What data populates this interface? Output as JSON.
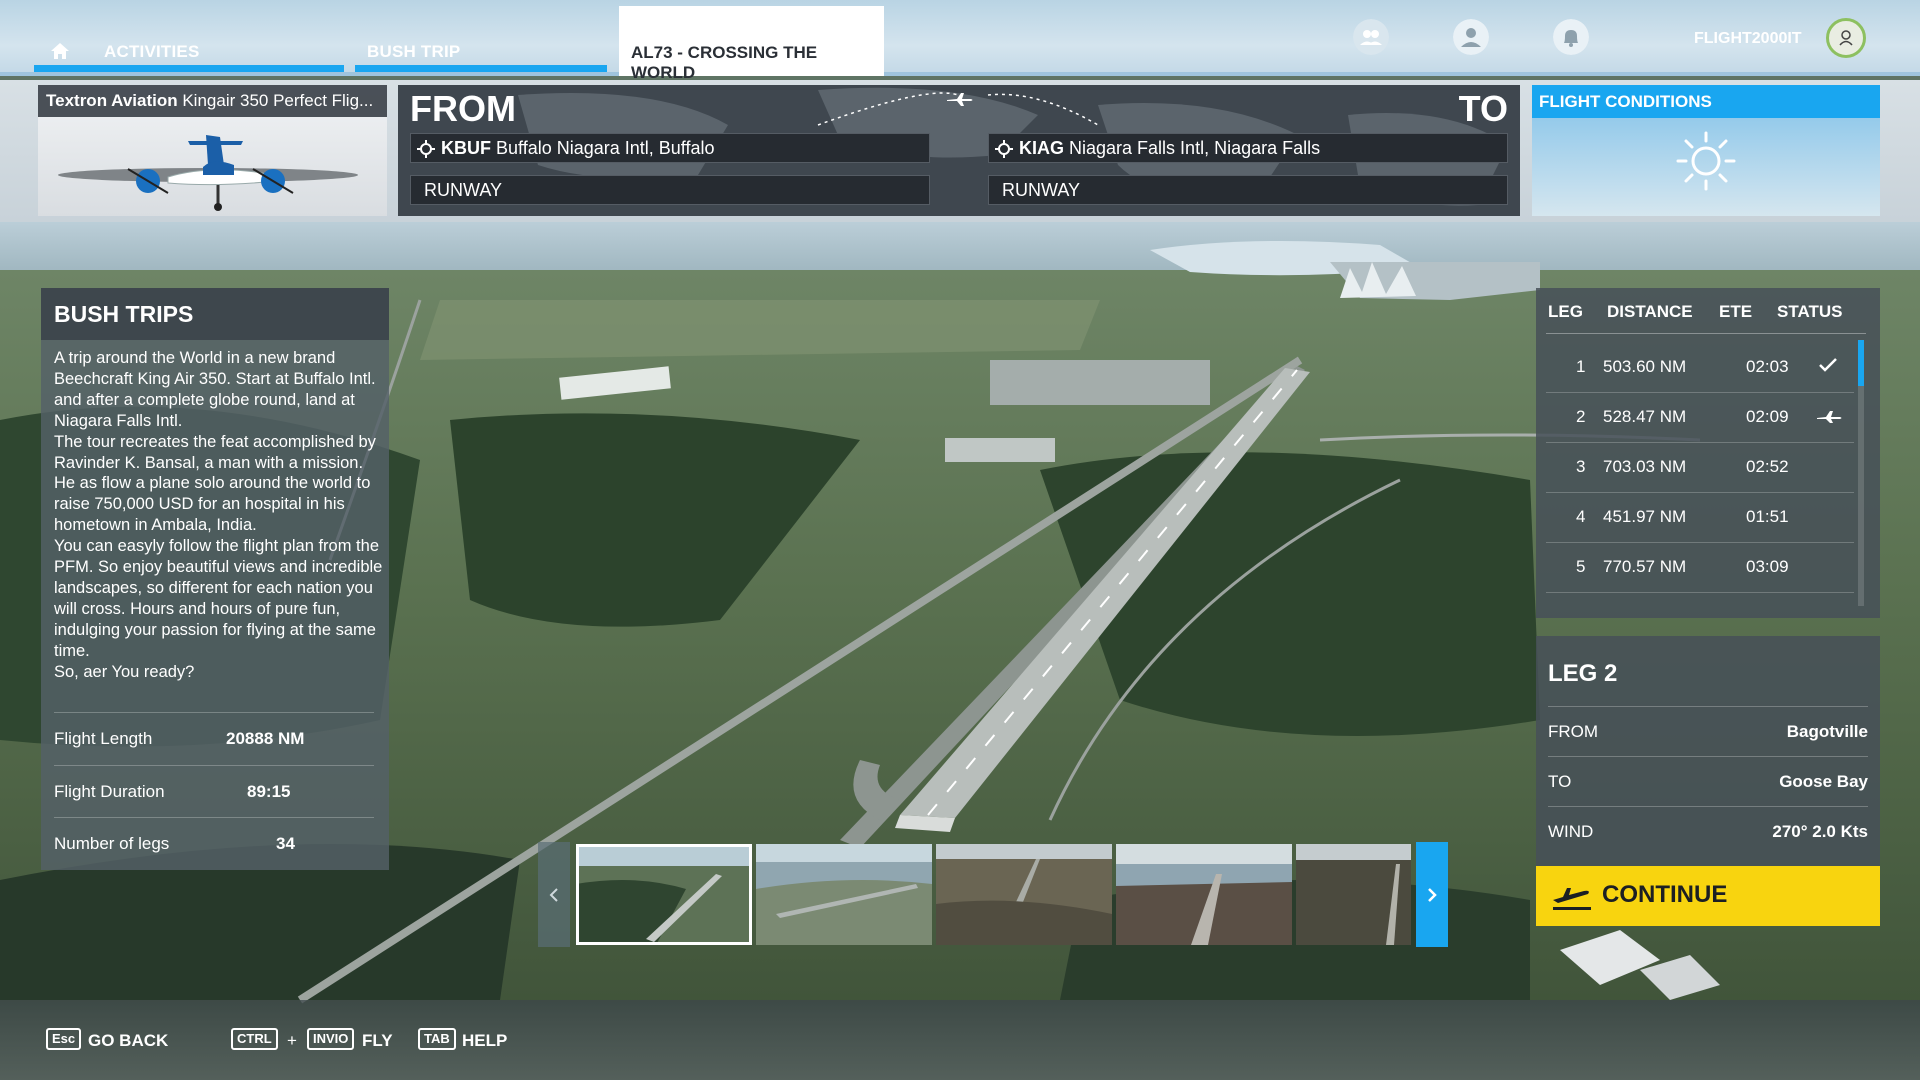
{
  "nav": {
    "activities_label": "ACTIVITIES",
    "bush_trip_label": "BUSH TRIP",
    "current_tab_label": "AL73 - CROSSING THE WORLD",
    "username": "FLIGHT2000IT",
    "icons": [
      "home-icon",
      "friends-icon",
      "profile-icon",
      "notifications-icon",
      "user-avatar-icon"
    ]
  },
  "aircraft": {
    "brand": "Textron Aviation",
    "model": "Kingair 350 Perfect Flig..."
  },
  "route": {
    "from_label": "FROM",
    "to_label": "TO",
    "from_code": "KBUF",
    "from_name": "Buffalo Niagara Intl, Buffalo",
    "to_code": "KIAG",
    "to_name": "Niagara Falls Intl, Niagara Falls",
    "from_runway": "RUNWAY",
    "to_runway": "RUNWAY"
  },
  "conditions": {
    "title": "FLIGHT CONDITIONS",
    "icon": "sun-icon"
  },
  "bush_trips": {
    "title": "BUSH TRIPS",
    "description": "A trip around the World in a new brand Beechcraft King Air 350. Start at Buffalo Intl. and after a complete globe round, land at Niagara Falls Intl.\nThe tour recreates the feat accomplished by Ravinder K. Bansal, a man with a mission. He as flow a plane solo around the world to raise 750,000 USD for an hospital in his hometown in Ambala, India.\nYou can easyly follow the flight plan from the PFM. So enjoy beautiful views and incredible landscapes, so different for each nation you will cross. Hours and hours of pure fun, indulging your passion for flying at the same time.\nSo, aer You ready?",
    "stats": [
      {
        "label": "Flight Length",
        "value": "20888 NM"
      },
      {
        "label": "Flight Duration",
        "value": "89:15"
      },
      {
        "label": "Number of legs",
        "value": "34"
      }
    ]
  },
  "legs_table": {
    "headers": [
      "LEG",
      "DISTANCE",
      "ETE",
      "STATUS"
    ],
    "rows": [
      {
        "leg": "1",
        "distance": "503.60 NM",
        "ete": "02:03",
        "status": "completed"
      },
      {
        "leg": "2",
        "distance": "528.47 NM",
        "ete": "02:09",
        "status": "current"
      },
      {
        "leg": "3",
        "distance": "703.03 NM",
        "ete": "02:52",
        "status": ""
      },
      {
        "leg": "4",
        "distance": "451.97 NM",
        "ete": "01:51",
        "status": ""
      },
      {
        "leg": "5",
        "distance": "770.57 NM",
        "ete": "03:09",
        "status": ""
      }
    ]
  },
  "leg_detail": {
    "title": "LEG 2",
    "rows": [
      {
        "label": "FROM",
        "value": "Bagotville"
      },
      {
        "label": "TO",
        "value": "Goose Bay"
      },
      {
        "label": "WIND",
        "value": "270° 2.0 Kts"
      }
    ],
    "continue_label": "CONTINUE"
  },
  "bottom_bar": {
    "go_back_key": "Esc",
    "go_back_label": "GO BACK",
    "fly_key_1": "CTRL",
    "fly_plus": "+",
    "fly_key_2": "INVIO",
    "fly_label": "FLY",
    "help_key": "TAB",
    "help_label": "HELP"
  },
  "colors": {
    "accent_blue": "#19a6f0",
    "continue_yellow": "#f8d40f",
    "panel_dark": "#3b424a"
  }
}
